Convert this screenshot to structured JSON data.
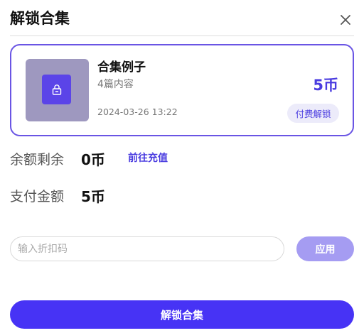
{
  "dialog": {
    "title": "解锁合集",
    "close_icon": "close-icon"
  },
  "collection": {
    "name": "合集例子",
    "count": "4篇内容",
    "date": "2024-03-26 13:22",
    "price": "5币",
    "badge": "付费解锁",
    "cover_icon": "lock-icon"
  },
  "balance": {
    "label": "余额剩余",
    "value": "0币",
    "recharge_label": "前往充值"
  },
  "payment": {
    "label": "支付金额",
    "value": "5币"
  },
  "discount": {
    "value": "",
    "placeholder": "输入折扣码",
    "apply_label": "应用"
  },
  "unlock_label": "解锁合集",
  "colors": {
    "accent": "#4733f5",
    "accent_text": "#4a3ce0",
    "apply_button": "#a59cf2",
    "cover": "#9e98bf"
  }
}
